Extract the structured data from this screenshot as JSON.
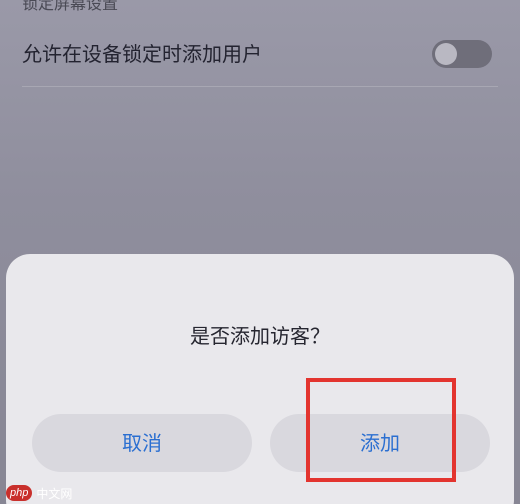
{
  "section_header": "锁定屏幕设置",
  "setting": {
    "label": "允许在设备锁定时添加用户",
    "toggle_state": "off"
  },
  "dialog": {
    "title": "是否添加访客？",
    "cancel_label": "取消",
    "add_label": "添加"
  },
  "watermark": {
    "logo": "php",
    "text": "中文网"
  },
  "colors": {
    "accent": "#2b6fd1",
    "highlight": "#e3342f"
  }
}
